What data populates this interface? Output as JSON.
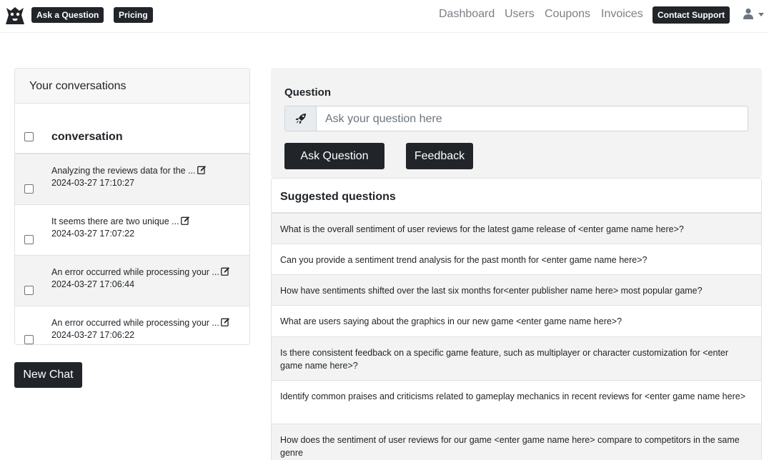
{
  "navbar": {
    "logo_icon": "bat-logo-icon",
    "ask_button": "Ask a Question",
    "pricing_button": "Pricing",
    "links": [
      "Dashboard",
      "Users",
      "Coupons",
      "Invoices"
    ],
    "contact_button": "Contact Support",
    "user_icon": "user-icon"
  },
  "conversations": {
    "header": "Your conversations",
    "column": "conversation",
    "rows": [
      {
        "title": "Analyzing the reviews data for the ...",
        "time": "2024-03-27 17:10:27"
      },
      {
        "title": "It seems there are two unique ...",
        "time": "2024-03-27 17:07:22"
      },
      {
        "title": "An error occurred while processing your ...",
        "time": "2024-03-27 17:06:44"
      },
      {
        "title": "An error occurred while processing your ...",
        "time": "2024-03-27 17:06:22"
      }
    ],
    "new_chat": "New Chat"
  },
  "question": {
    "label": "Question",
    "placeholder": "Ask your question here",
    "ask_button": "Ask Question",
    "feedback_button": "Feedback"
  },
  "suggested": {
    "title": "Suggested questions",
    "items": [
      "What is the overall sentiment of user reviews for the latest game release of <enter game name here>?",
      "Can you provide a sentiment trend analysis for the past month for <enter game name here>?",
      "How have sentiments shifted over the last six months for<enter publisher name here> most popular game?",
      "What are users saying about the graphics in our new game <enter game name here>?",
      "Is there consistent feedback on a specific game feature, such as multiplayer or character customization for <enter game name here>?",
      "Identify common praises and criticisms related to gameplay mechanics in recent reviews for <enter game name here>",
      "How does the sentiment of user reviews for our game <enter game name here> compare to competitors in the same genre"
    ]
  }
}
